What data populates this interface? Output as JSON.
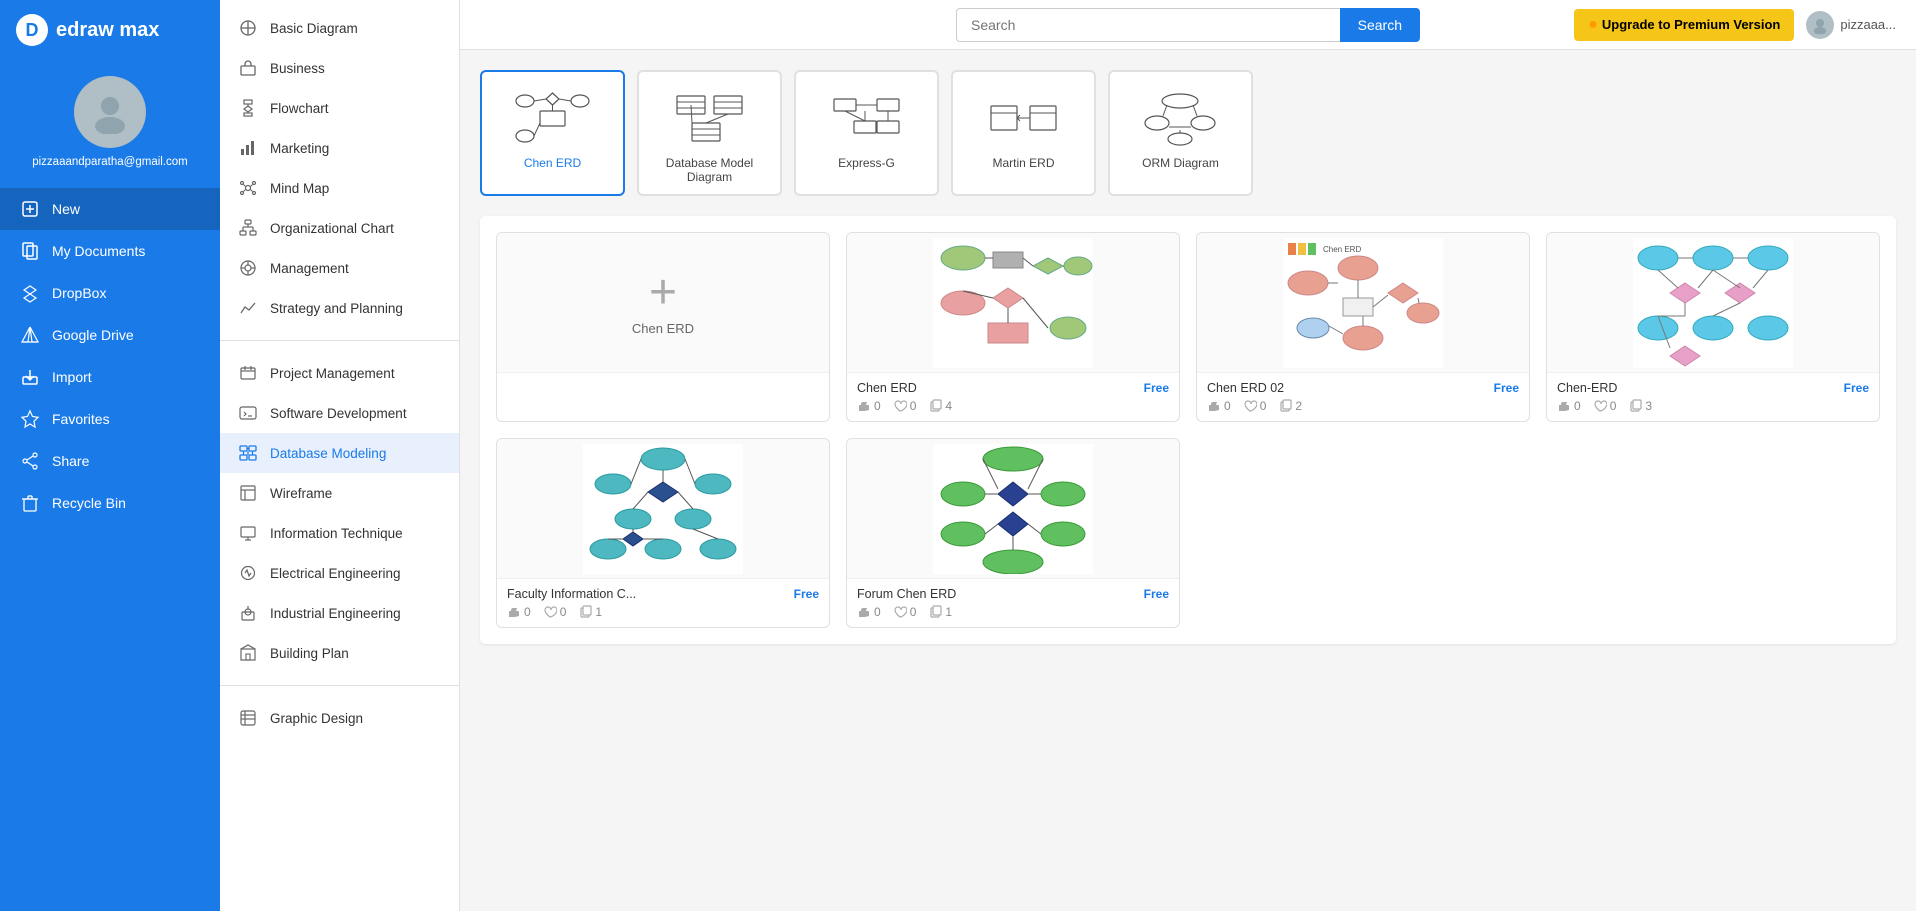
{
  "app": {
    "name": "edraw max",
    "logo_letter": "D"
  },
  "user": {
    "email": "pizzaaandparatha@gmail.com",
    "display": "pizzaaa..."
  },
  "topbar": {
    "search_placeholder": "Search",
    "search_button": "Search",
    "upgrade_button": "Upgrade to Premium Version"
  },
  "sidebar": {
    "items": [
      {
        "id": "new",
        "label": "New",
        "active": true
      },
      {
        "id": "my-documents",
        "label": "My Documents",
        "active": false
      },
      {
        "id": "dropbox",
        "label": "DropBox",
        "active": false
      },
      {
        "id": "google-drive",
        "label": "Google Drive",
        "active": false
      },
      {
        "id": "import",
        "label": "Import",
        "active": false
      },
      {
        "id": "favorites",
        "label": "Favorites",
        "active": false
      },
      {
        "id": "share",
        "label": "Share",
        "active": false
      },
      {
        "id": "recycle-bin",
        "label": "Recycle Bin",
        "active": false
      }
    ]
  },
  "middle_menu": {
    "categories": [
      {
        "id": "basic-diagram",
        "label": "Basic Diagram"
      },
      {
        "id": "business",
        "label": "Business"
      },
      {
        "id": "flowchart",
        "label": "Flowchart"
      },
      {
        "id": "marketing",
        "label": "Marketing"
      },
      {
        "id": "mind-map",
        "label": "Mind Map"
      },
      {
        "id": "organizational-chart",
        "label": "Organizational Chart"
      },
      {
        "id": "management",
        "label": "Management"
      },
      {
        "id": "strategy-and-planning",
        "label": "Strategy and Planning"
      }
    ],
    "categories2": [
      {
        "id": "project-management",
        "label": "Project Management"
      },
      {
        "id": "software-development",
        "label": "Software Development"
      },
      {
        "id": "database-modeling",
        "label": "Database Modeling",
        "active": true
      },
      {
        "id": "wireframe",
        "label": "Wireframe"
      },
      {
        "id": "information-technique",
        "label": "Information Technique"
      },
      {
        "id": "electrical-engineering",
        "label": "Electrical Engineering"
      },
      {
        "id": "industrial-engineering",
        "label": "Industrial Engineering"
      },
      {
        "id": "building-plan",
        "label": "Building Plan"
      }
    ],
    "categories3": [
      {
        "id": "graphic-design",
        "label": "Graphic Design"
      }
    ]
  },
  "diagram_types": [
    {
      "id": "chen-erd",
      "label": "Chen ERD",
      "selected": true
    },
    {
      "id": "database-model-diagram",
      "label": "Database Model Diagram",
      "selected": false
    },
    {
      "id": "express-g",
      "label": "Express-G",
      "selected": false
    },
    {
      "id": "martin-erd",
      "label": "Martin ERD",
      "selected": false
    },
    {
      "id": "orm-diagram",
      "label": "ORM Diagram",
      "selected": false
    }
  ],
  "templates": [
    {
      "id": "create-new",
      "type": "create",
      "label": "Chen ERD"
    },
    {
      "id": "chen-erd-1",
      "title": "Chen ERD",
      "badge": "Free",
      "likes": "0",
      "hearts": "0",
      "copies": "4",
      "type": "template"
    },
    {
      "id": "chen-erd-02",
      "title": "Chen ERD 02",
      "badge": "Free",
      "likes": "0",
      "hearts": "0",
      "copies": "2",
      "type": "template"
    },
    {
      "id": "chen-erd-3",
      "title": "Chen-ERD",
      "badge": "Free",
      "likes": "0",
      "hearts": "0",
      "copies": "3",
      "type": "template"
    },
    {
      "id": "faculty-info",
      "title": "Faculty Information C...",
      "badge": "Free",
      "likes": "0",
      "hearts": "0",
      "copies": "1",
      "type": "template"
    },
    {
      "id": "forum-chen-erd",
      "title": "Forum Chen ERD",
      "badge": "Free",
      "likes": "0",
      "hearts": "0",
      "copies": "1",
      "type": "template"
    }
  ]
}
